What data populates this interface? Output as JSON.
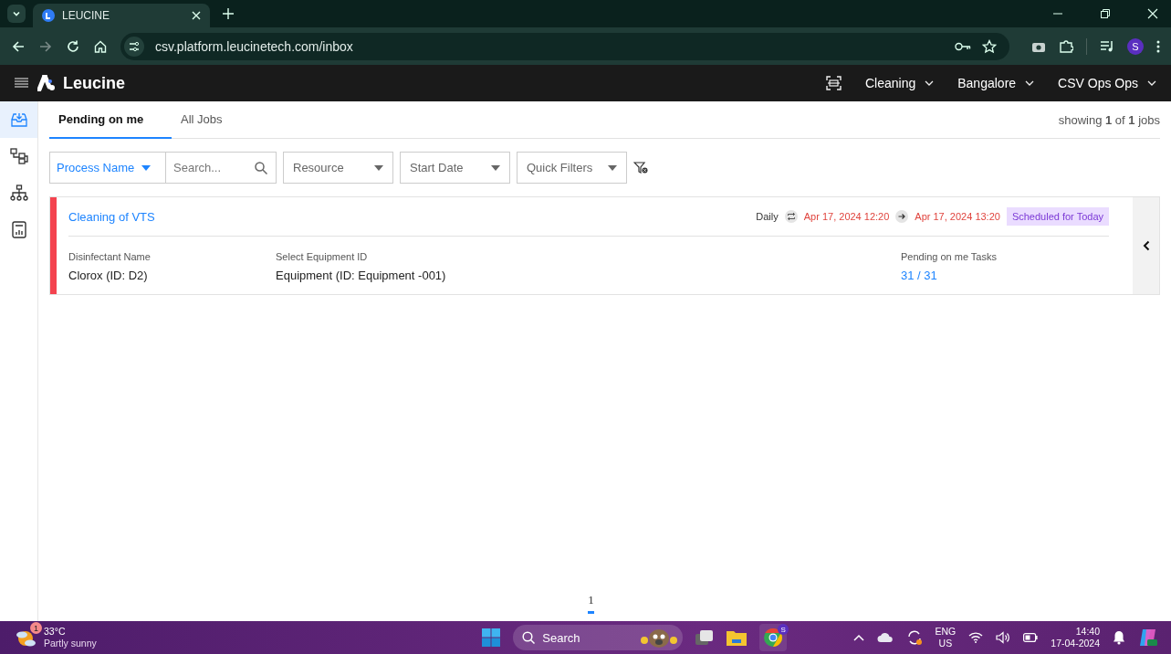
{
  "browser": {
    "tab_title": "LEUCINE",
    "url": "csv.platform.leucinetech.com/inbox",
    "profile_initial": "S"
  },
  "app_header": {
    "brand": "Leucine",
    "dropdowns": [
      "Cleaning",
      "Bangalore",
      "CSV Ops Ops"
    ]
  },
  "sidebar": {
    "items": [
      {
        "kind": "inbox",
        "selected": true
      },
      {
        "kind": "flow",
        "selected": false
      },
      {
        "kind": "tree",
        "selected": false
      },
      {
        "kind": "report",
        "selected": false
      }
    ]
  },
  "tabs": [
    {
      "label": "Pending on me",
      "selected": true
    },
    {
      "label": "All Jobs",
      "selected": false
    }
  ],
  "showing": "showing **1** of **1** jobs",
  "filters": {
    "process_name": "Process Name",
    "search": {
      "placeholder": "Search..."
    },
    "dropdowns": [
      "Resource",
      "Start Date",
      "Quick Filters"
    ]
  },
  "jobs": [
    {
      "title": "Cleaning of VTS",
      "recurrence": "Daily",
      "start": "Apr 17, 2024 12:20",
      "end": "Apr 17, 2024 13:20",
      "status": "Scheduled for Today",
      "color": "#f4434f",
      "fields": [
        {
          "label": "Disinfectant Name",
          "value": "Clorox (ID: D2)"
        },
        {
          "label": "Select Equipment ID",
          "value": "Equipment (ID: Equipment -001)"
        }
      ],
      "tasks_label": "Pending on me Tasks",
      "tasks_value": "31 / 31"
    }
  ],
  "pagination": [
    {
      "label": "1",
      "selected": true
    }
  ],
  "taskbar": {
    "weather_badge": "1",
    "temperature": "33°C",
    "weather": "Partly sunny",
    "search": "Search",
    "chrome_badge": "S",
    "language": "ENG",
    "region": "US",
    "time": "14:40",
    "date": "17-04-2024"
  }
}
